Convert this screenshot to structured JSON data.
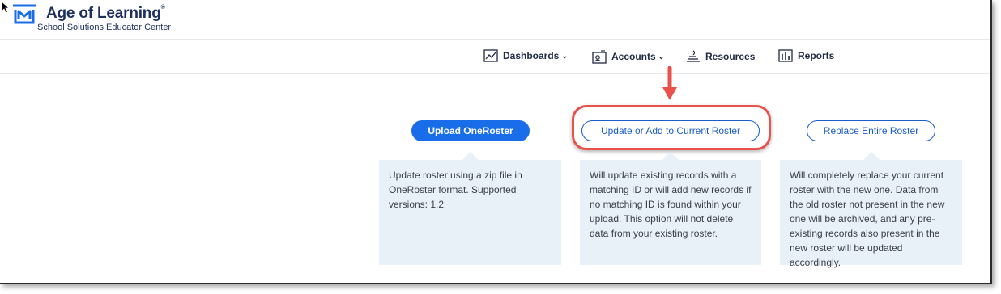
{
  "brand": {
    "name": "Age of Learning",
    "reg": "®",
    "subtitle": "School Solutions Educator Center"
  },
  "nav": {
    "dashboards": "Dashboards",
    "accounts": "Accounts",
    "resources": "Resources",
    "reports": "Reports"
  },
  "options": [
    {
      "button": "Upload OneRoster",
      "description": "Update roster using a zip file in OneRoster format. Supported versions: 1.2"
    },
    {
      "button": "Update or Add to Current Roster",
      "description": "Will update existing records with a matching ID or will add new records if no matching ID is found within your upload. This option will not delete data from your existing roster."
    },
    {
      "button": "Replace Entire Roster",
      "description": "Will completely replace your current roster with the new one. Data from the old roster not present in the new one will be archived, and any pre-existing records also present in the new roster will be updated accordingly."
    }
  ],
  "colors": {
    "primary": "#1a6de8",
    "highlight": "#e8524a",
    "info_bg": "#e8f0f8",
    "brand": "#1d2f5e"
  },
  "icons": {
    "logo": "age-of-learning-logo",
    "dashboards": "line-chart-icon",
    "accounts": "account-card-icon",
    "resources": "resources-icon",
    "reports": "bar-chart-icon"
  }
}
